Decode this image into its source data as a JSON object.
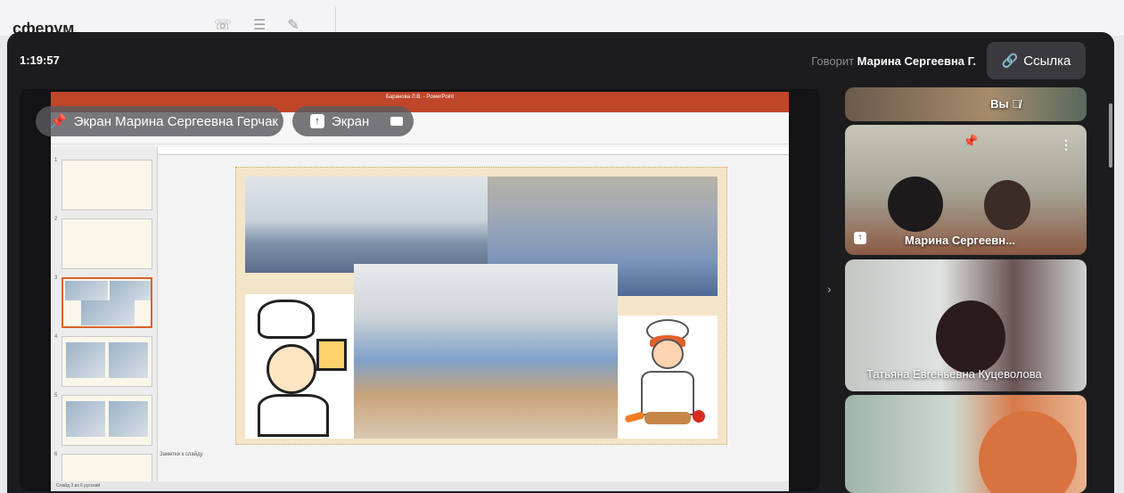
{
  "background_app": {
    "logo": "сферум"
  },
  "call": {
    "timer": "1:19:57",
    "speaker_prefix": "Говорит",
    "speaker_name": "Марина Сергеевна Г.",
    "link_label": "Ссылка",
    "link_icon": "link-icon"
  },
  "screen_share": {
    "owner_label": "Экран Марина Сергеевна Герчак",
    "owner_icon": "pin-icon",
    "screen_button_label": "Экран",
    "screen_button_icon": "share-screen-icon",
    "camera_icon": "camera-icon"
  },
  "powerpoint": {
    "window_title": "Баранова Л.В. - PowerPoint",
    "notes_placeholder": "Заметки к слайду",
    "status_left": "Слайд 3 из 6   русский",
    "thumbnail_numbers": [
      "1",
      "2",
      "3",
      "4",
      "5",
      "6"
    ],
    "active_slide": 3
  },
  "participants": [
    {
      "name": "Вы",
      "muted": true
    },
    {
      "name": "Марина Сергеевн...",
      "pinned": true
    },
    {
      "name": "Татьяна Евгеньевна Куцеволова"
    },
    {
      "name": ""
    }
  ],
  "colors": {
    "accent_ppt": "#c0462a",
    "call_bg": "#1c1c1f",
    "active_thumb": "#d9622b"
  }
}
